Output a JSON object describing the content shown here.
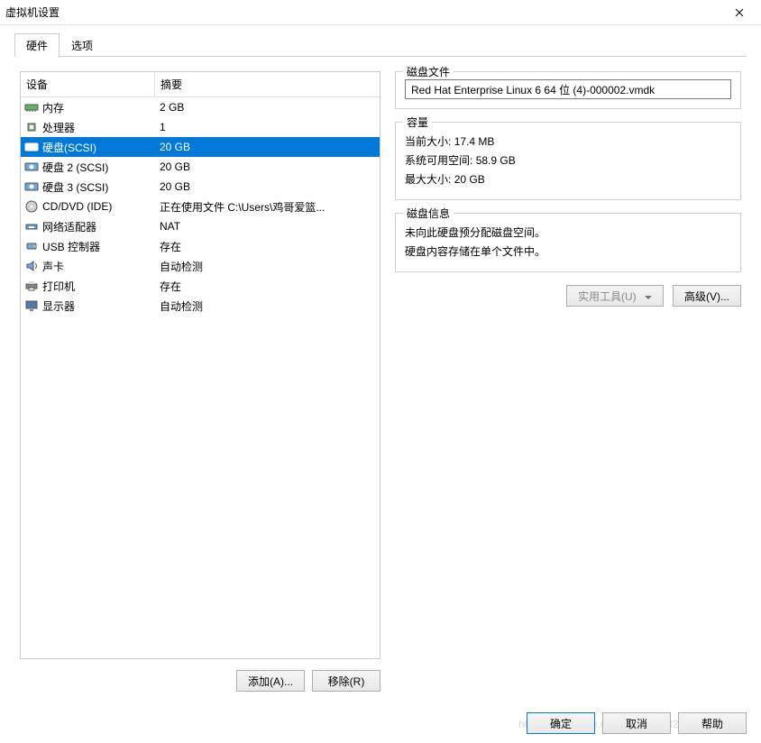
{
  "window": {
    "title": "虚拟机设置"
  },
  "tabs": {
    "hardware": "硬件",
    "options": "选项"
  },
  "hw_headers": {
    "device": "设备",
    "summary": "摘要"
  },
  "devices": [
    {
      "icon": "memory",
      "name": "内存",
      "summary": "2 GB",
      "selected": false
    },
    {
      "icon": "cpu",
      "name": "处理器",
      "summary": "1",
      "selected": false
    },
    {
      "icon": "disk",
      "name": "硬盘(SCSI)",
      "summary": "20 GB",
      "selected": true
    },
    {
      "icon": "disk",
      "name": "硬盘 2 (SCSI)",
      "summary": "20 GB",
      "selected": false
    },
    {
      "icon": "disk",
      "name": "硬盘 3 (SCSI)",
      "summary": "20 GB",
      "selected": false
    },
    {
      "icon": "cd",
      "name": "CD/DVD (IDE)",
      "summary": "正在使用文件 C:\\Users\\鸡哥爱篮...",
      "selected": false
    },
    {
      "icon": "network",
      "name": "网络适配器",
      "summary": "NAT",
      "selected": false
    },
    {
      "icon": "usb",
      "name": "USB 控制器",
      "summary": "存在",
      "selected": false
    },
    {
      "icon": "sound",
      "name": "声卡",
      "summary": "自动检测",
      "selected": false
    },
    {
      "icon": "printer",
      "name": "打印机",
      "summary": "存在",
      "selected": false
    },
    {
      "icon": "display",
      "name": "显示器",
      "summary": "自动检测",
      "selected": false
    }
  ],
  "hw_buttons": {
    "add": "添加(A)...",
    "remove": "移除(R)"
  },
  "disk_file": {
    "legend": "磁盘文件",
    "value": "Red Hat Enterprise Linux 6 64 位 (4)-000002.vmdk"
  },
  "capacity": {
    "legend": "容量",
    "current_label": "当前大小:",
    "current_value": "17.4 MB",
    "free_label": "系统可用空间:",
    "free_value": "58.9 GB",
    "max_label": "最大大小:",
    "max_value": "20 GB"
  },
  "disk_info": {
    "legend": "磁盘信息",
    "line1": "未向此硬盘预分配磁盘空间。",
    "line2": "硬盘内容存储在单个文件中。"
  },
  "right_buttons": {
    "utilities": "实用工具(U)",
    "advanced": "高级(V)..."
  },
  "footer": {
    "ok": "确定",
    "cancel": "取消",
    "help": "帮助"
  },
  "watermark": "https://blog.csdn.net/qq_41918325"
}
